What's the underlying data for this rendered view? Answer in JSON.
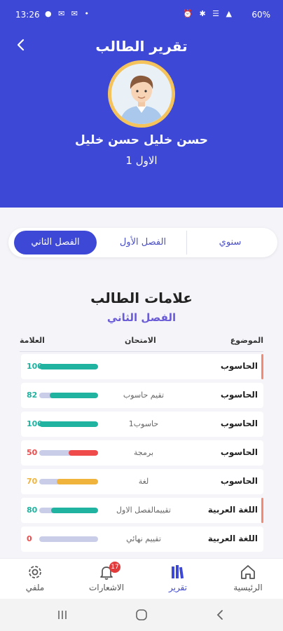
{
  "status_bar": {
    "time": "13:26",
    "left_icons": "● ✉ ✉ •",
    "right_icons": "⏰ ✱ ☰ ▲",
    "battery": "60%"
  },
  "header": {
    "title": "تقرير الطالب",
    "student_name": "حسن خليل حسن خليل",
    "grade": "الاول 1"
  },
  "tabs": {
    "annual": "سنوي",
    "first_term": "الفصل الأول",
    "second_term": "الفصل الثاني",
    "active": "second_term"
  },
  "marks": {
    "title": "علامات الطالب",
    "subtitle": "الفصل الثاني",
    "columns": {
      "subject": "الموضوع",
      "exam": "الامتحان",
      "mark": "العلامة"
    },
    "rows": [
      {
        "subject": "الحاسوب",
        "exam": "",
        "score": "100",
        "percent": 100,
        "color": "#1fb3a0",
        "marked": true
      },
      {
        "subject": "الحاسوب",
        "exam": "تقيم حاسوب",
        "score": "82",
        "percent": 82,
        "color": "#1fb3a0",
        "marked": false
      },
      {
        "subject": "الحاسوب",
        "exam": "حاسوب1",
        "score": "100",
        "percent": 100,
        "color": "#1fb3a0",
        "marked": false
      },
      {
        "subject": "الحاسوب",
        "exam": "برمجة",
        "score": "50",
        "percent": 50,
        "color": "#ef4b4b",
        "marked": false
      },
      {
        "subject": "الحاسوب",
        "exam": "لغة",
        "score": "70",
        "percent": 70,
        "color": "#f0b43c",
        "marked": false
      },
      {
        "subject": "اللغة العربية",
        "exam": "تقييمالفصل الاول",
        "score": "80",
        "percent": 80,
        "color": "#1fb3a0",
        "marked": true
      },
      {
        "subject": "اللغة العربية",
        "exam": "تقييم نهائي",
        "score": "0",
        "percent": 0,
        "color": "#ef4b4b",
        "marked": false
      }
    ]
  },
  "bottom_nav": {
    "home": "الرئيسية",
    "report": "تقرير",
    "notifications": "الاشعارات",
    "notifications_badge": "17",
    "profile": "ملفي"
  }
}
